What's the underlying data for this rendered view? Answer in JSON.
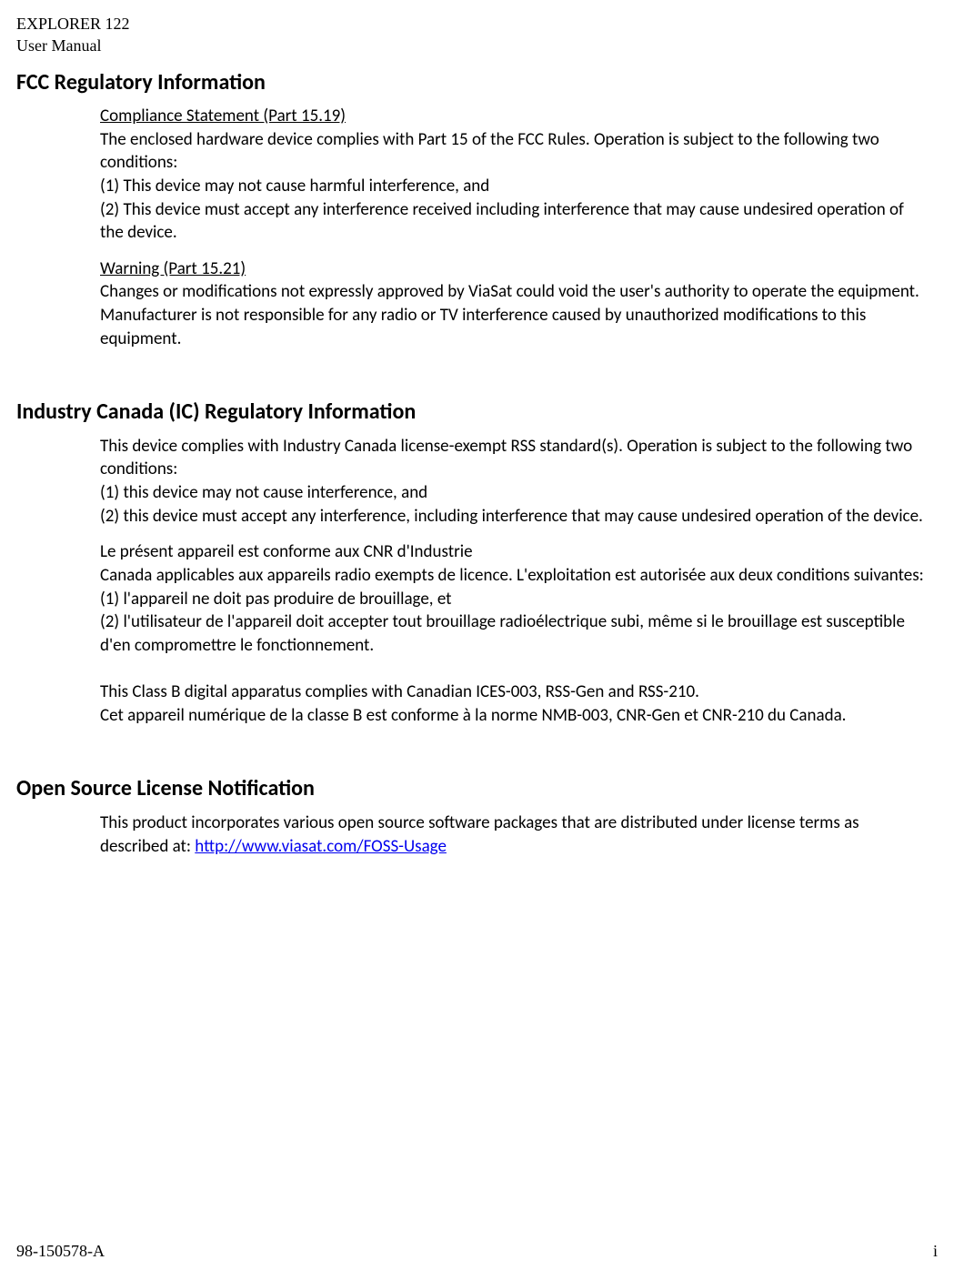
{
  "header": {
    "line1": "EXPLORER 122",
    "line2": "User Manual"
  },
  "section1": {
    "title": "FCC Regulatory Information",
    "block1": {
      "heading": "Compliance Statement (Part 15.19)",
      "l1": "The enclosed hardware device complies with Part 15 of the FCC Rules. Operation is subject to the following two conditions:",
      "l2": "(1) This device may not cause harmful interference, and",
      "l3": "(2) This device must accept any interference received including interference that may cause undesired operation of the device."
    },
    "block2": {
      "heading": "Warning (Part 15.21)",
      "l1": "Changes or modifications not expressly approved by ViaSat could void the user's authority to operate the equipment. Manufacturer is not responsible for any radio or TV interference caused by unauthorized modifications to this equipment."
    }
  },
  "section2": {
    "title": "Industry Canada (IC) Regulatory Information",
    "block1": {
      "l1": "This device complies with Industry Canada license-exempt RSS standard(s). Operation is subject to the following two conditions:",
      "l2": "(1) this device may not cause interference, and",
      "l3": "(2) this device must accept any interference, including interference that may cause undesired operation of the device."
    },
    "block2": {
      "l1": "Le présent appareil est conforme aux CNR d'Industrie",
      "l2": "Canada applicables aux appareils radio exempts de licence. L'exploitation est autorisée aux deux conditions suivantes:",
      "l3": "(1) l'appareil ne doit pas produire de brouillage, et",
      "l4": "(2) l'utilisateur de l'appareil doit accepter tout brouillage radioélectrique subi, même si le brouillage est susceptible d'en compromettre le fonctionnement."
    },
    "block3": {
      "l1": "This Class B digital apparatus complies with Canadian ICES-003, RSS-Gen and RSS-210.",
      "l2": "Cet appareil numérique de la classe B est conforme à la norme NMB-003, CNR-Gen et CNR-210 du Canada."
    }
  },
  "section3": {
    "title": "Open Source License Notification",
    "block1": {
      "l1_pre": "This product incorporates various open source software packages that are distributed under license terms as described at: ",
      "link_text": "http://www.viasat.com/FOSS-Usage",
      "link_href": "http://www.viasat.com/FOSS-Usage"
    }
  },
  "footer": {
    "left": "98-150578-A",
    "right": "i"
  }
}
